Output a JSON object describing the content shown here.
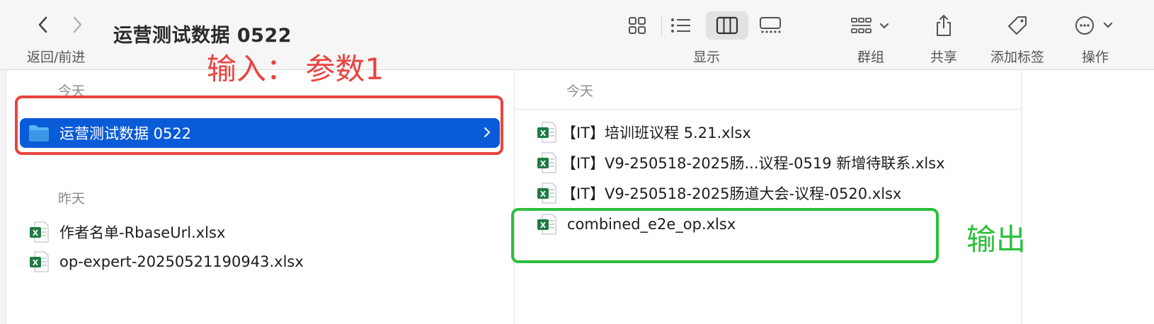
{
  "window": {
    "title": "运营测试数据 0522"
  },
  "toolbar": {
    "nav_label": "返回/前进",
    "view_label": "显示",
    "group_label": "群组",
    "share_label": "共享",
    "tags_label": "添加标签",
    "action_label": "操作"
  },
  "column1": {
    "today_header": "今天",
    "yesterday_header": "昨天",
    "today_items": [
      {
        "name": "运营测试数据 0522",
        "icon": "folder-icon"
      }
    ],
    "yesterday_items": [
      {
        "name": "作者名单-RbaseUrl.xlsx",
        "icon": "excel-file-icon"
      },
      {
        "name": "op-expert-20250521190943.xlsx",
        "icon": "excel-file-icon"
      }
    ]
  },
  "column2": {
    "today_header": "今天",
    "items": [
      {
        "name": "【IT】培训班议程 5.21.xlsx",
        "icon": "excel-file-icon"
      },
      {
        "name": "【IT】V9-250518-2025肠...议程-0519 新增待联系.xlsx",
        "icon": "excel-file-icon"
      },
      {
        "name": "【IT】V9-250518-2025肠道大会-议程-0520.xlsx",
        "icon": "excel-file-icon"
      },
      {
        "name": "combined_e2e_op.xlsx",
        "icon": "excel-file-icon"
      }
    ]
  },
  "annotations": {
    "input_label": "输入： 参数1",
    "output_label": "输出",
    "input_color": "#e8443f",
    "output_color": "#2cbf3c"
  },
  "colors": {
    "selection": "#0a5bd8",
    "folder": "#4aa3f0",
    "excel": "#1f7a44"
  }
}
